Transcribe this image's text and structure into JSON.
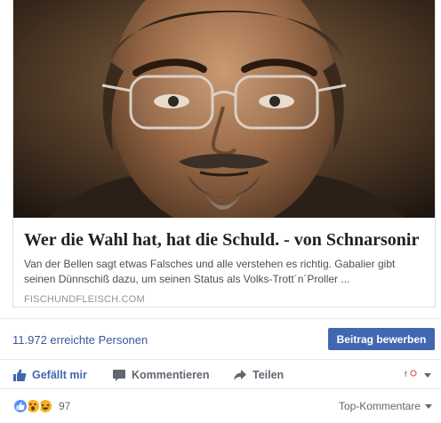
{
  "link_preview": {
    "title": "Wer die Wahl hat, hat die Schuld. - von Schnarsonir",
    "description": "Van der Bellen sagt etwas Falsches und alle verstehen es richtig. Gabalier gibt seinen Dünnschiß dazu, um seinen Status als Volks-Trott´n´Proller ...",
    "domain": "FISCHUNDFLEISCH.COM"
  },
  "reach": {
    "text": "11.972 erreichte Personen",
    "promote_label": "Beitrag bewerben"
  },
  "actions": {
    "like_label": "Gefällt mir",
    "comment_label": "Kommentieren",
    "share_label": "Teilen"
  },
  "reactions": {
    "count": "97",
    "sort_label": "Top-Kommentare"
  },
  "colors": {
    "accent": "#4267b2",
    "link": "#365899",
    "muted": "#606770"
  }
}
